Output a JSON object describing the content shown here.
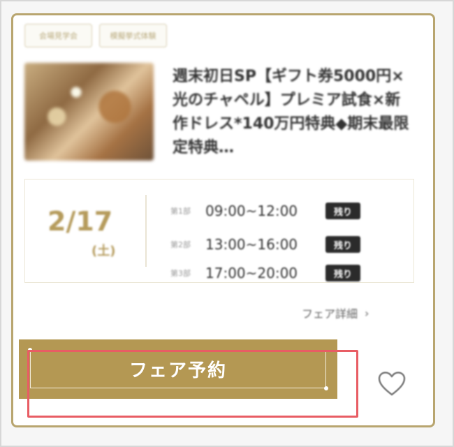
{
  "card": {
    "tags": [
      "会場見学会",
      "模擬挙式体験"
    ],
    "title": "週末初日SP【ギフト券5000円×光のチャペル】プレミア試食×新作ドレス*140万円特典◆期末最限定特典…",
    "date": {
      "day": "2/17",
      "weekday": "(土)"
    },
    "slots": [
      {
        "label": "第1部",
        "time": "09:00~12:00",
        "status": "残り"
      },
      {
        "label": "第2部",
        "time": "13:00~16:00",
        "status": "残り"
      },
      {
        "label": "第3部",
        "time": "17:00~20:00",
        "status": "残り"
      }
    ],
    "details_label": "フェア詳細",
    "details_arrow": "›",
    "reserve_label": "フェア予約",
    "favorite_icon": "heart-outline-icon"
  },
  "colors": {
    "accent": "#b49853",
    "card_border": "#b8a56f",
    "highlight": "#e85d64",
    "badge": "#2b2b2b"
  }
}
